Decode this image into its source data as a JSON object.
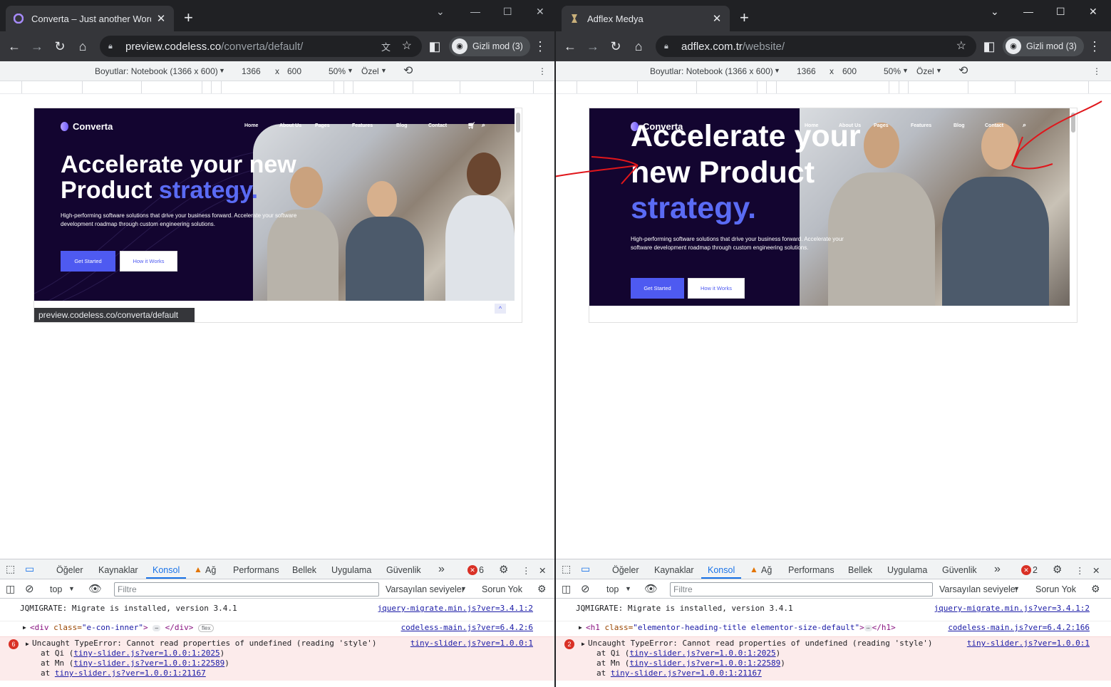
{
  "left": {
    "tab_title": "Converta – Just another WordPr",
    "url_domain": "preview.codeless.co",
    "url_path": "/converta/default/",
    "profile": "Gizli mod (3)",
    "dims_label": "Boyutlar: Notebook (1366 x 600)",
    "width": "1366",
    "times": "x",
    "height": "600",
    "zoom": "50%",
    "throttle": "Özel",
    "status_url": "preview.codeless.co/converta/default",
    "site": {
      "logo": "Converta",
      "nav": [
        "Home",
        "About Us",
        "Pages",
        "Features",
        "Blog",
        "Contact"
      ],
      "h1_line1": "Accelerate your new",
      "h1_line2": "Product ",
      "h1_accent": "strategy.",
      "sub": "High-performing software solutions that drive your business forward. Accelerate your software development roadmap through custom engineering solutions.",
      "btn_primary": "Get Started",
      "btn_secondary": "How it Works"
    },
    "devtools": {
      "tabs": [
        "Öğeler",
        "Kaynaklar",
        "Konsol",
        "Ağ",
        "Performans",
        "Bellek",
        "Uygulama",
        "Güvenlik"
      ],
      "more": "»",
      "errors": "6",
      "context": "top",
      "filter_ph": "Filtre",
      "levels": "Varsayılan seviyeler",
      "issues": "Sorun Yok",
      "log1": "JQMIGRATE: Migrate is installed, version 3.4.1",
      "log1_src": "jquery-migrate.min.js?ver=3.4.1:2",
      "log2_tag": "<div",
      "log2_attr": " class=",
      "log2_val": "\"e-con-inner\"",
      "log2_end": ">",
      "log2_close": "</div>",
      "log2_badge": "flex",
      "log2_src": "codeless-main.js?ver=6.4.2:6",
      "err_count": "6",
      "err_msg": "Uncaught TypeError: Cannot read properties of undefined (reading 'style')",
      "err_src": "tiny-slider.js?ver=1.0.0:1",
      "stack": [
        {
          "pre": "at Qi (",
          "link": "tiny-slider.js?ver=1.0.0:1:2025",
          "post": ")"
        },
        {
          "pre": "at Mn (",
          "link": "tiny-slider.js?ver=1.0.0:1:22589",
          "post": ")"
        },
        {
          "pre": "at ",
          "link": "tiny-slider.js?ver=1.0.0:1:21167",
          "post": ""
        }
      ]
    }
  },
  "right": {
    "tab_title": "Adflex Medya",
    "url_domain": "adflex.com.tr",
    "url_path": "/website/",
    "profile": "Gizli mod (3)",
    "dims_label": "Boyutlar: Notebook (1366 x 600)",
    "width": "1366",
    "times": "x",
    "height": "600",
    "zoom": "50%",
    "throttle": "Özel",
    "site": {
      "logo": "Converta",
      "nav": [
        "Home",
        "About Us",
        "Pages",
        "Features",
        "Blog",
        "Contact"
      ],
      "h1_line1": "Accelerate your",
      "h1_line2": "new Product",
      "h1_accent": "strategy.",
      "sub": "High-performing software solutions that drive your business forward. Accelerate your software development roadmap through custom engineering solutions.",
      "btn_primary": "Get Started",
      "btn_secondary": "How it Works"
    },
    "devtools": {
      "tabs": [
        "Öğeler",
        "Kaynaklar",
        "Konsol",
        "Ağ",
        "Performans",
        "Bellek",
        "Uygulama",
        "Güvenlik"
      ],
      "more": "»",
      "errors": "2",
      "context": "top",
      "filter_ph": "Filtre",
      "levels": "Varsayılan seviyeler",
      "issues": "Sorun Yok",
      "log1": "JQMIGRATE: Migrate is installed, version 3.4.1",
      "log1_src": "jquery-migrate.min.js?ver=3.4.1:2",
      "log2_tag": "<h1",
      "log2_attr": " class=",
      "log2_val": "\"elementor-heading-title elementor-size-default\"",
      "log2_end": ">",
      "log2_close": "</h1>",
      "log2_src": "codeless-main.js?ver=6.4.2:166",
      "err_count": "2",
      "err_msg": "Uncaught TypeError: Cannot read properties of undefined (reading 'style')",
      "err_src": "tiny-slider.js?ver=1.0.0:1",
      "stack": [
        {
          "pre": "at Qi (",
          "link": "tiny-slider.js?ver=1.0.0:1:2025",
          "post": ")"
        },
        {
          "pre": "at Mn (",
          "link": "tiny-slider.js?ver=1.0.0:1:22589",
          "post": ")"
        },
        {
          "pre": "at ",
          "link": "tiny-slider.js?ver=1.0.0:1:21167",
          "post": ""
        }
      ]
    }
  },
  "colors": {
    "accent": "#5a6bf4",
    "hero_bg": "#130530",
    "annotation": "#e0161b"
  }
}
